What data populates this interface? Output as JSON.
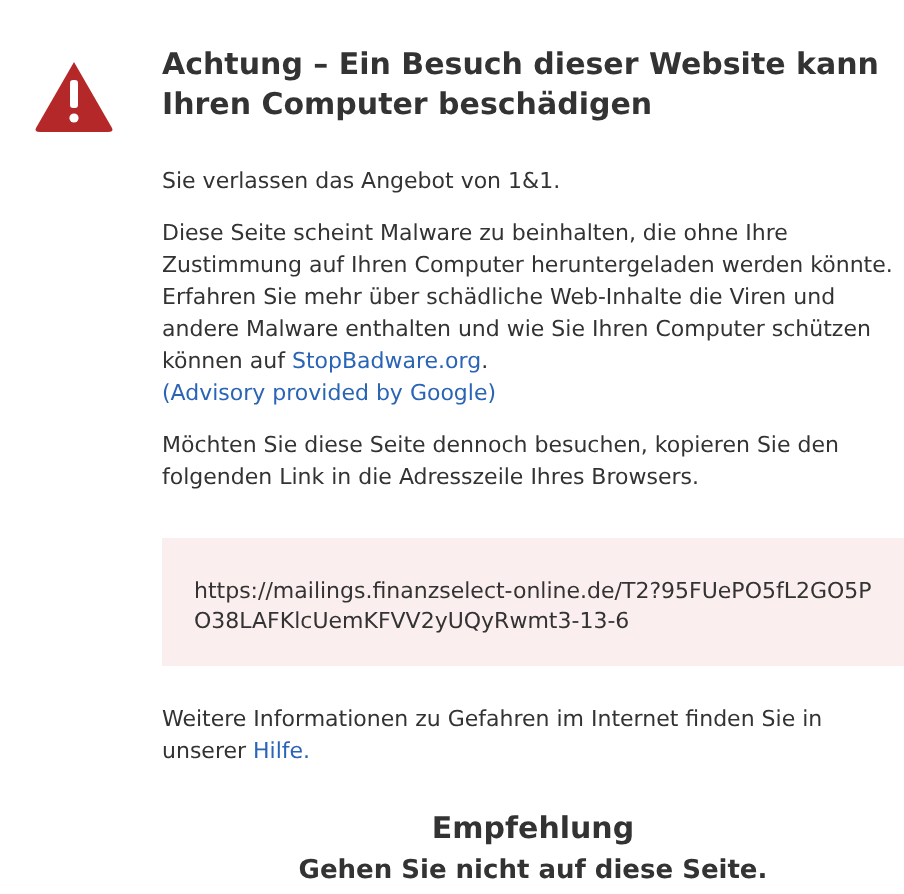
{
  "title": "Achtung – Ein Besuch dieser Website kann Ihren Computer beschädigen",
  "paragraphs": [
    [
      {
        "kind": "text",
        "text": "Sie verlassen das Angebot von 1&1."
      }
    ],
    [
      {
        "kind": "text",
        "text": "Diese Seite scheint Malware zu beinhalten, die ohne Ihre Zustimmung auf Ihren Computer heruntergeladen werden könnte. Erfahren Sie mehr über schädliche Web-Inhalte die Viren und andere Malware enthalten und wie Sie Ihren Computer schützen können auf "
      },
      {
        "kind": "link",
        "text": "StopBadware.org"
      },
      {
        "kind": "text",
        "text": "."
      },
      {
        "kind": "break"
      },
      {
        "kind": "link",
        "text": "(Advisory provided by Google)"
      }
    ],
    [
      {
        "kind": "text",
        "text": "Möchten Sie diese Seite dennoch besuchen, kopieren Sie den folgenden Link in die Adresszeile Ihres Browsers."
      }
    ]
  ],
  "url": "https://mailings.finanzselect-online.de/T2?95FUePO5fL2GO5PO38LAFKlcUemKFVV2yUQyRwmt3-13-6",
  "more_info": [
    {
      "kind": "text",
      "text": "Weitere Informationen zu Gefahren im Internet finden Sie in unserer "
    },
    {
      "kind": "link",
      "text": "Hilfe."
    }
  ],
  "recommendation": {
    "heading": "Empfehlung",
    "text": "Gehen Sie nicht auf diese Seite."
  }
}
